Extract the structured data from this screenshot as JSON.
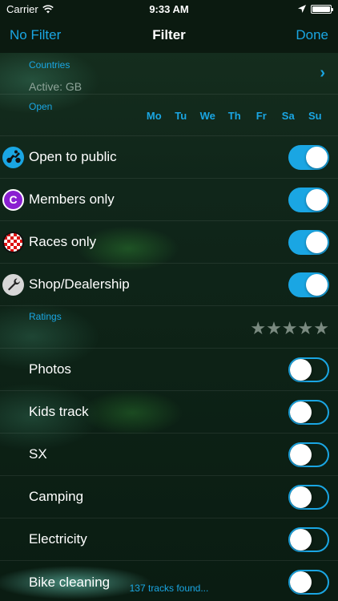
{
  "status_bar": {
    "carrier": "Carrier",
    "time": "9:33 AM"
  },
  "nav": {
    "left_label": "No Filter",
    "title": "Filter",
    "right_label": "Done"
  },
  "countries": {
    "label": "Countries",
    "active": "Active: GB"
  },
  "open": {
    "label": "Open",
    "days": [
      "Mo",
      "Tu",
      "We",
      "Th",
      "Fr",
      "Sa",
      "Su"
    ]
  },
  "track_types": [
    {
      "label": "Open to public",
      "icon": "rider-icon",
      "on": true
    },
    {
      "label": "Members only",
      "icon": "members-c-icon",
      "on": true
    },
    {
      "label": "Races only",
      "icon": "checkered-flag-icon",
      "on": true
    },
    {
      "label": "Shop/Dealership",
      "icon": "wrench-icon",
      "on": true
    }
  ],
  "ratings": {
    "label": "Ratings",
    "stars_total": 5,
    "stars_selected": 0
  },
  "features": [
    {
      "label": "Photos",
      "on": false
    },
    {
      "label": "Kids track",
      "on": false
    },
    {
      "label": "SX",
      "on": false
    },
    {
      "label": "Camping",
      "on": false
    },
    {
      "label": "Electricity",
      "on": false
    },
    {
      "label": "Bike cleaning",
      "on": false
    }
  ],
  "footer": {
    "tracks_found": "137 tracks found..."
  },
  "colors": {
    "accent": "#1aa6e3",
    "members_purple": "#8a1fd1",
    "races_red": "#dd1111"
  }
}
